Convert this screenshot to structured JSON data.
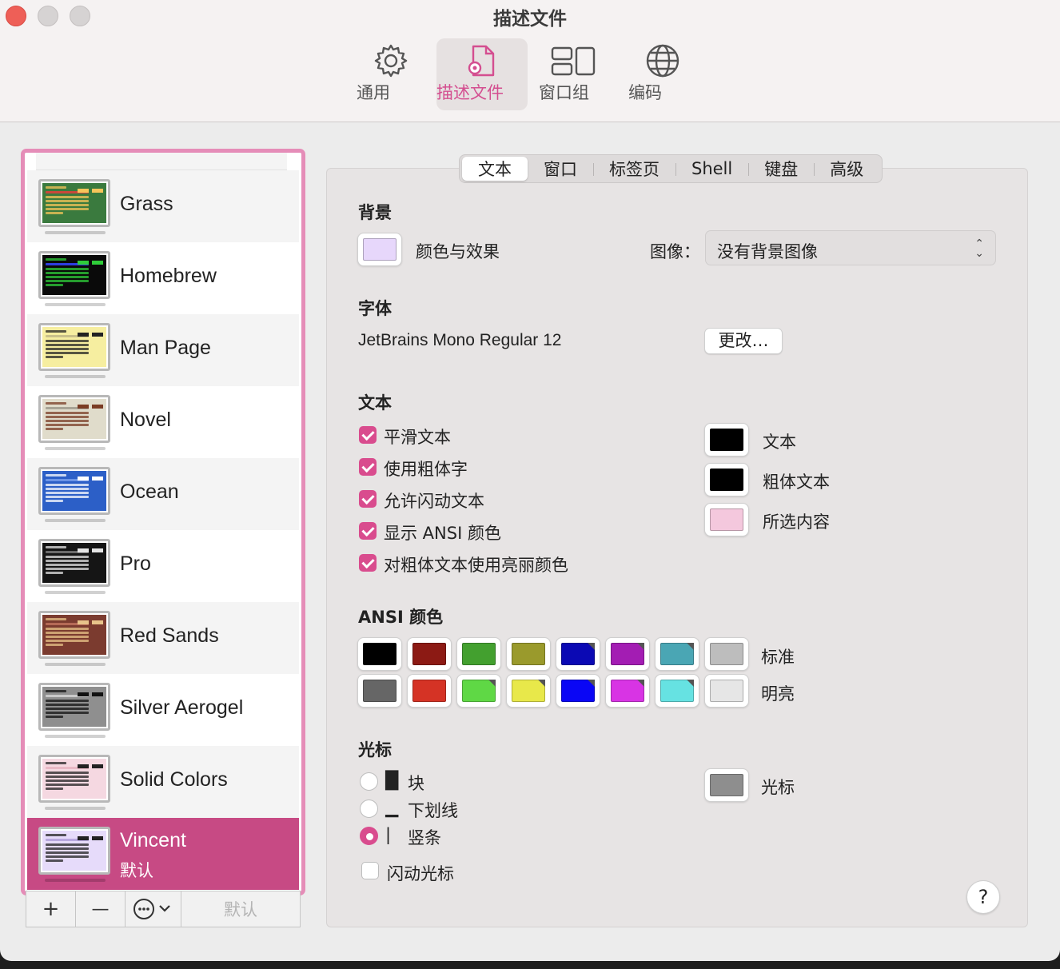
{
  "window": {
    "title": "描述文件"
  },
  "toolbar": {
    "items": [
      {
        "label": "通用",
        "icon": "gear-icon"
      },
      {
        "label": "描述文件",
        "icon": "document-gear-icon",
        "active": true
      },
      {
        "label": "窗口组",
        "icon": "window-group-icon"
      },
      {
        "label": "编码",
        "icon": "globe-icon"
      }
    ]
  },
  "profiles": [
    {
      "name": "Grass",
      "bg": "#3a7a3e",
      "fg": "#f7c55a",
      "hl": "#c8483a"
    },
    {
      "name": "Homebrew",
      "bg": "#0a0a0a",
      "fg": "#2fcd3a",
      "hl": "#2d3de0"
    },
    {
      "name": "Man Page",
      "bg": "#f6eea0",
      "fg": "#222222",
      "hl": "#c9c08a"
    },
    {
      "name": "Novel",
      "bg": "#e0dccb",
      "fg": "#7a3c24",
      "hl": "#a8a496"
    },
    {
      "name": "Ocean",
      "bg": "#2c5fc7",
      "fg": "#ffffff",
      "hl": "#6c94e6"
    },
    {
      "name": "Pro",
      "bg": "#151515",
      "fg": "#e5e5e5",
      "hl": "#6a6a6a"
    },
    {
      "name": "Red Sands",
      "bg": "#7b3b2f",
      "fg": "#e8c48a",
      "hl": "#b56a56"
    },
    {
      "name": "Silver Aerogel",
      "bg": "#8f8f8f",
      "fg": "#111111",
      "hl": "#c9c9c9"
    },
    {
      "name": "Solid Colors",
      "bg": "#f5d8e1",
      "fg": "#222222",
      "hl": "#e9b9c6"
    },
    {
      "name": "Vincent",
      "bg": "#e6dbfa",
      "fg": "#222222",
      "hl": "#b9a8e0",
      "default_label": "默认",
      "selected": true
    }
  ],
  "list_controls": {
    "add": "+",
    "remove": "—",
    "more": "···",
    "default": "默认"
  },
  "tabs": [
    "文本",
    "窗口",
    "标签页",
    "Shell",
    "键盘",
    "高级"
  ],
  "background": {
    "heading": "背景",
    "color_effects_label": "颜色与效果",
    "color": "#e7d7fb",
    "image_label": "图像：",
    "image_value": "没有背景图像"
  },
  "font": {
    "heading": "字体",
    "value": "JetBrains Mono Regular 12",
    "change_button": "更改…"
  },
  "text": {
    "heading": "文本",
    "options": [
      {
        "label": "平滑文本",
        "checked": true
      },
      {
        "label": "使用粗体字",
        "checked": true
      },
      {
        "label": "允许闪动文本",
        "checked": true
      },
      {
        "label": "显示 ANSI 颜色",
        "checked": true
      },
      {
        "label": "对粗体文本使用亮丽颜色",
        "checked": true
      }
    ],
    "colors": [
      {
        "label": "文本",
        "color": "#000000"
      },
      {
        "label": "粗体文本",
        "color": "#000000"
      },
      {
        "label": "所选内容",
        "color": "#f4c8dd"
      }
    ]
  },
  "ansi": {
    "heading": "ANSI 颜色",
    "normal_label": "标准",
    "bright_label": "明亮",
    "normal": [
      "#000000",
      "#8c1a14",
      "#43a02f",
      "#9a9a2c",
      "#0b09b4",
      "#a31db3",
      "#4aa6b4",
      "#bdbdbd"
    ],
    "bright": [
      "#666666",
      "#d53325",
      "#5fd845",
      "#e8e84a",
      "#0a06f5",
      "#d834e4",
      "#66e2e2",
      "#e6e6e6"
    ]
  },
  "cursor": {
    "heading": "光标",
    "options": [
      {
        "glyph": "█",
        "label": "块",
        "selected": false
      },
      {
        "glyph": "▁",
        "label": "下划线",
        "selected": false
      },
      {
        "glyph": "|",
        "label": "竖条",
        "selected": true
      }
    ],
    "blink_label": "闪动光标",
    "blink": false,
    "color_label": "光标",
    "color": "#8e8e8e"
  },
  "help": "?"
}
